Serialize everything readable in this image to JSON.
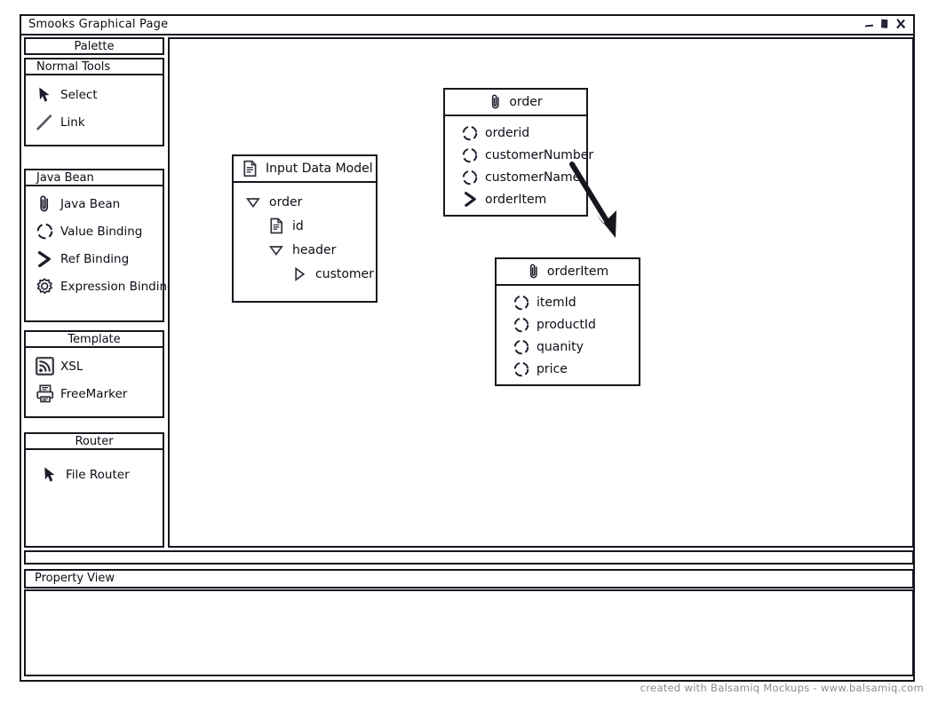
{
  "window": {
    "title": "Smooks Graphical Page",
    "controls": [
      {
        "name": "minimize",
        "glyph": "minimize-icon"
      },
      {
        "name": "maximize",
        "glyph": "maximize-icon"
      },
      {
        "name": "close",
        "glyph": "close-icon"
      }
    ]
  },
  "palette": {
    "title": "Palette",
    "sections": [
      {
        "label": "Normal Tools",
        "align": "left",
        "items": [
          {
            "label": "Select",
            "icon": "cursor-icon"
          },
          {
            "label": "Link",
            "icon": "line-icon"
          }
        ]
      },
      {
        "label": "Java Bean",
        "align": "left",
        "items": [
          {
            "label": "Java Bean",
            "icon": "paperclip-icon"
          },
          {
            "label": "Value Binding",
            "icon": "dashed-circle-icon"
          },
          {
            "label": "Ref Binding",
            "icon": "chevron-right-icon"
          },
          {
            "label": "Expression Binding",
            "icon": "gear-icon"
          }
        ]
      },
      {
        "label": "Template",
        "align": "center",
        "items": [
          {
            "label": "XSL",
            "icon": "feed-icon"
          },
          {
            "label": "FreeMarker",
            "icon": "printer-icon"
          }
        ]
      },
      {
        "label": "Router",
        "align": "center",
        "items": [
          {
            "label": "File Router",
            "icon": "cursor-icon"
          }
        ]
      }
    ]
  },
  "canvas": {
    "input_data_model": {
      "title": "Input Data Model",
      "title_icon": "document-icon",
      "tree": [
        {
          "label": "order",
          "icon": "triangle-down-icon",
          "depth": 0
        },
        {
          "label": "id",
          "icon": "document-icon",
          "depth": 1
        },
        {
          "label": "header",
          "icon": "triangle-down-icon",
          "depth": 1
        },
        {
          "label": "customer",
          "icon": "triangle-right-icon",
          "depth": 2
        }
      ]
    },
    "bean_order": {
      "title": "order",
      "title_icon": "paperclip-icon",
      "rows": [
        {
          "label": "orderid",
          "icon": "dashed-circle-icon"
        },
        {
          "label": "customerNumber",
          "icon": "dashed-circle-icon"
        },
        {
          "label": "customerName",
          "icon": "dashed-circle-icon"
        },
        {
          "label": "orderItem",
          "icon": "chevron-right-icon"
        }
      ]
    },
    "bean_order_item": {
      "title": "orderItem",
      "title_icon": "paperclip-icon",
      "rows": [
        {
          "label": "itemId",
          "icon": "dashed-circle-icon"
        },
        {
          "label": "productId",
          "icon": "dashed-circle-icon"
        },
        {
          "label": "quanity",
          "icon": "dashed-circle-icon"
        },
        {
          "label": "price",
          "icon": "dashed-circle-icon"
        }
      ]
    },
    "connector": {
      "name": "order-to-orderitem-arrow"
    }
  },
  "property_view": {
    "title": "Property View",
    "content": ""
  },
  "footer": {
    "credit": "created with Balsamiq Mockups - www.balsamiq.com"
  },
  "colors": {
    "ink": "#16161f",
    "paper": "#ffffff",
    "muted": "#8c8c8c"
  }
}
